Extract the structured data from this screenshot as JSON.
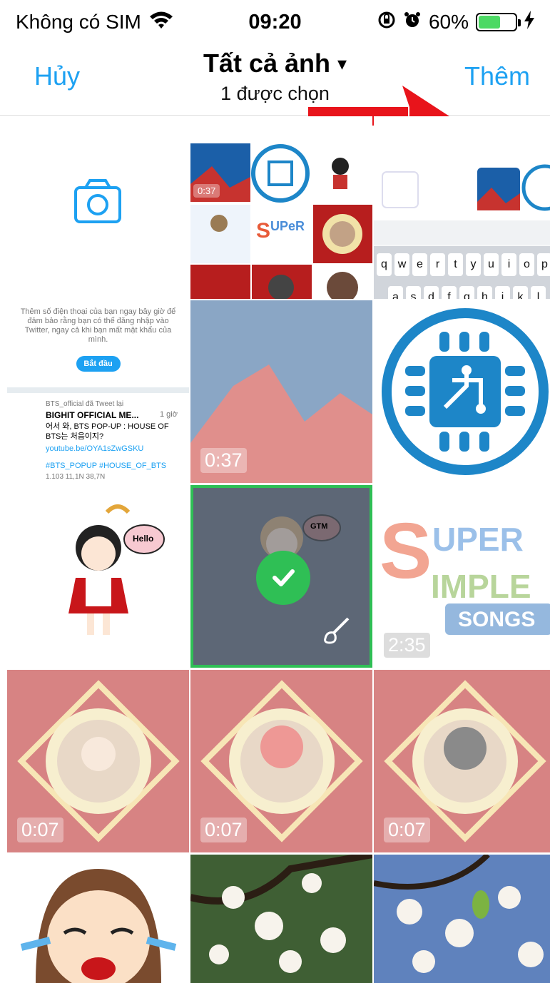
{
  "status_bar": {
    "carrier": "Không có SIM",
    "time": "09:20",
    "battery_percent": "60%",
    "battery_level": 0.6,
    "wifi_icon": "wifi-icon",
    "rotation_lock_icon": "rotation-lock-icon",
    "alarm_icon": "alarm-icon",
    "charging_icon": "charging-icon"
  },
  "nav": {
    "cancel_label": "Hủy",
    "title": "Tất cả ảnh",
    "title_caret": "▾",
    "subtitle": "1 được chọn",
    "add_label": "Thêm"
  },
  "colors": {
    "accent": "#1da1f2",
    "selected": "#2fbf55",
    "arrow": "#e8141b"
  },
  "twitter_card": {
    "prompt": "Thêm số điện thoại của bạn ngay bây giờ để đảm bảo rằng bạn có thể đăng nhập vào Twitter, ngay cả khi bạn mất mật khẩu của mình.",
    "start_button": "Bắt đầu",
    "retweet_line": "BTS_official đã Tweet lại",
    "account": "BIGHIT OFFICIAL ME...",
    "time": "1 giờ",
    "tweet_text": "어서 와, BTS POP-UP : HOUSE OF BTS는 처음이지?",
    "link": "youtube.be/OYA1sZwGSKU",
    "hashtags": "#BTS_POPUP #HOUSE_OF_BTS",
    "stats": "1.103   11,1N   38,7N"
  },
  "keyboard_row1": [
    "q",
    "w",
    "e",
    "r",
    "t",
    "y",
    "u",
    "i",
    "o",
    "p"
  ],
  "keyboard_row2": [
    "a",
    "s",
    "d",
    "f",
    "g",
    "h",
    "j",
    "k",
    "l"
  ],
  "thumbnails": [
    {
      "type": "camera"
    },
    {
      "type": "collage"
    },
    {
      "type": "keyboard-screenshot"
    },
    {
      "type": "twitter-screenshot"
    },
    {
      "type": "video",
      "duration": "0:37"
    },
    {
      "type": "chip-logo"
    },
    {
      "type": "sticker",
      "bubble": "Hello"
    },
    {
      "type": "sticker-selected",
      "bubble": "GTM"
    },
    {
      "type": "video",
      "duration": "2:35",
      "logo_words": [
        "SUPER",
        "SIMPLE",
        "SONGS"
      ]
    },
    {
      "type": "video",
      "duration": "0:07"
    },
    {
      "type": "video",
      "duration": "0:07"
    },
    {
      "type": "video",
      "duration": "0:07"
    },
    {
      "type": "sticker-crying"
    },
    {
      "type": "photo-blossom"
    },
    {
      "type": "photo-blossom"
    }
  ]
}
